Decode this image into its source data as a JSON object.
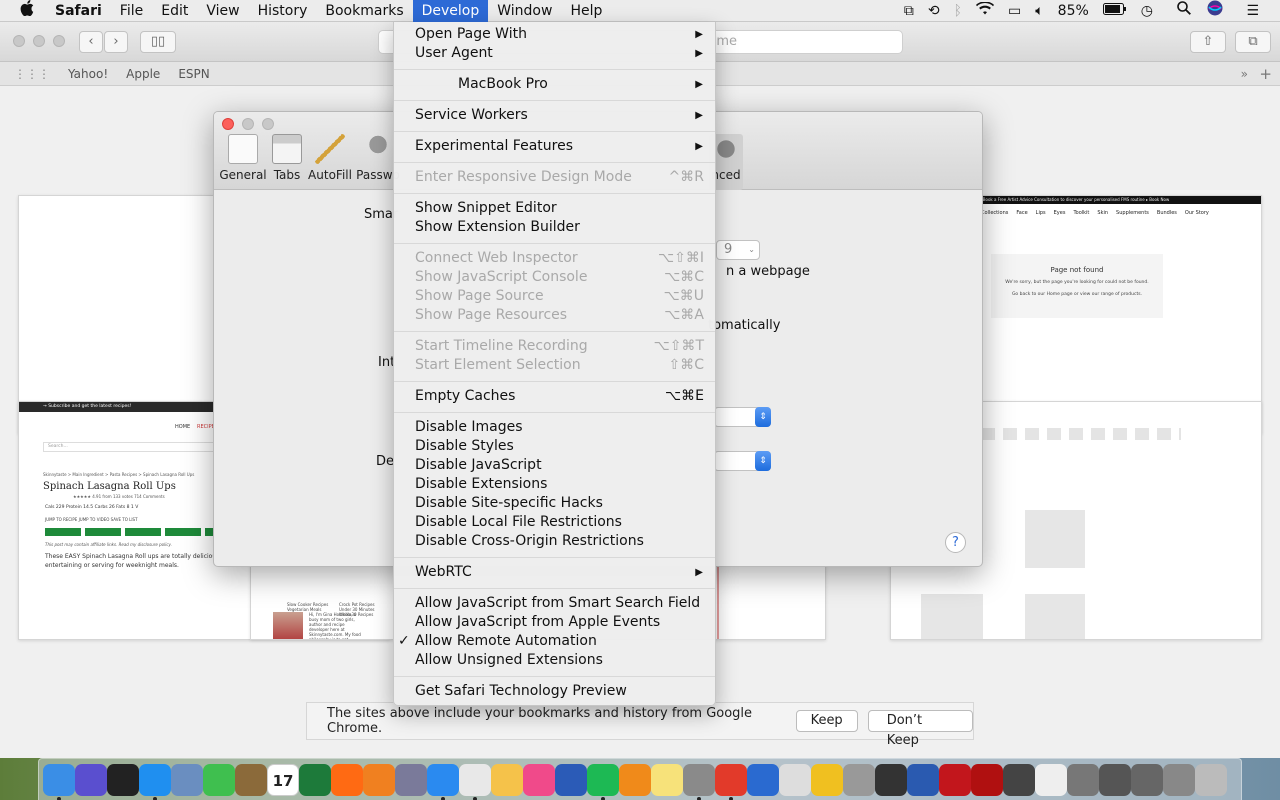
{
  "menubar": {
    "apple": "",
    "app": "Safari",
    "items": [
      "File",
      "Edit",
      "View",
      "History",
      "Bookmarks",
      "Develop",
      "Window",
      "Help"
    ],
    "battery": "85%"
  },
  "favorites": [
    "Yahoo!",
    "Apple",
    "ESPN"
  ],
  "address_placeholder": "me",
  "prefs": {
    "tabs": [
      "General",
      "Tabs",
      "AutoFill",
      "Passwo",
      "nced"
    ],
    "labels": {
      "smart": "Smar",
      "int": "Int",
      "de": "De",
      "webpage": "n a webpage",
      "auto": "tomatically",
      "num": "9"
    },
    "help": "?"
  },
  "develop_menu": {
    "open_page_with": "Open Page With",
    "user_agent": "User Agent",
    "macbook_pro": "MacBook Pro",
    "service_workers": "Service Workers",
    "experimental_features": "Experimental Features",
    "responsive": "Enter Responsive Design Mode",
    "responsive_sc": "^⌘R",
    "snippet": "Show Snippet Editor",
    "ext_builder": "Show Extension Builder",
    "connect_inspector": "Connect Web Inspector",
    "connect_inspector_sc": "⌥⇧⌘I",
    "js_console": "Show JavaScript Console",
    "js_console_sc": "⌥⌘C",
    "page_source": "Show Page Source",
    "page_source_sc": "⌥⌘U",
    "page_resources": "Show Page Resources",
    "page_resources_sc": "⌥⌘A",
    "timeline": "Start Timeline Recording",
    "timeline_sc": "⌥⇧⌘T",
    "element_selection": "Start Element Selection",
    "element_selection_sc": "⇧⌘C",
    "empty_caches": "Empty Caches",
    "empty_caches_sc": "⌥⌘E",
    "disable_images": "Disable Images",
    "disable_styles": "Disable Styles",
    "disable_js": "Disable JavaScript",
    "disable_ext": "Disable Extensions",
    "disable_hacks": "Disable Site-specific Hacks",
    "disable_local": "Disable Local File Restrictions",
    "disable_cors": "Disable Cross-Origin Restrictions",
    "webrtc": "WebRTC",
    "allow_js_search": "Allow JavaScript from Smart Search Field",
    "allow_js_apple": "Allow JavaScript from Apple Events",
    "allow_remote": "Allow Remote Automation",
    "allow_remote_check": "✓",
    "allow_unsigned": "Allow Unsigned Extensions",
    "tech_preview": "Get Safari Technology Preview"
  },
  "notice": {
    "text": "The sites above include your bookmarks and history from Google Chrome.",
    "keep": "Keep",
    "dont_keep": "Don’t Keep"
  },
  "thumbs": {
    "recipe_banner": "→ Subscribe and get the latest recipes!",
    "recipe_nav_home": "HOME",
    "recipe_nav_recipes": "RECIPES",
    "recipe_search": "Search...",
    "recipe_crumb": "Skinnytaste > Main Ingredient > Pasta Recipes > Spinach Lasagna Roll Ups",
    "recipe_title": "Spinach Lasagna Roll Ups",
    "recipe_rating": "★★★★★ 4.91 from 133 votes 714 Comments",
    "recipe_nutri": "Cals 229  Protein 14.5  Carbs 26  Fats 8  1 V",
    "recipe_jump": "JUMP TO RECIPE   JUMP TO VIDEO   SAVE TO LIST",
    "recipe_disclaimer": "This post may contain affiliate links. Read my disclosure policy.",
    "recipe_body": "These EASY Spinach Lasagna Roll ups are totally delicious, perfect for entertaining or serving for weeknight meals.",
    "author_blurb": "Hi, I'm Gina Homolka, a busy mom of two girls, author and recipe developer here at Skinnytaste.com. My food philosophy is to eat",
    "cats": "Slow Cooker Recipes Vegetarian Meals",
    "cats2": "Crock Pot Recipes Under 30 Minutes Whole30 Recipes",
    "shop_banner": "Book a Free Artist Advice Consultation to discover your personalised FMS routine ▸ Book Now",
    "shop_nav": [
      "Collections",
      "Face",
      "Lips",
      "Eyes",
      "Toolkit",
      "Skin",
      "Supplements",
      "Bundles",
      "Our Story"
    ],
    "nf_title": "Page not found",
    "nf_text": "We're sorry, but the page you're looking for could not be found.",
    "nf_link": "Go back to our Home page or view our range of products."
  },
  "dock_icons": [
    "finder-icon",
    "siri-icon",
    "photo-booth-icon",
    "app-store-icon",
    "preview-icon",
    "facetime-icon",
    "notes-icon",
    "calendar-icon",
    "excel-icon",
    "firefox-icon",
    "pages-icon",
    "launchpad-icon",
    "safari-icon",
    "chrome-icon",
    "photos-icon",
    "itunes-icon",
    "word-icon",
    "spotify-icon",
    "ibooks-icon",
    "stickies-icon",
    "system-prefs-icon",
    "acrobat-icon",
    "quicktime-icon",
    "block-icon",
    "o-icon",
    "no-entry-icon",
    "printer-icon",
    "chart-icon",
    "acrobat2-icon",
    "flash-icon",
    "phone-icon",
    "doc-icon",
    "stack-icon",
    "stack2-icon",
    "stack3-icon",
    "stack4-icon",
    "trash-icon"
  ],
  "dock_date": "17"
}
